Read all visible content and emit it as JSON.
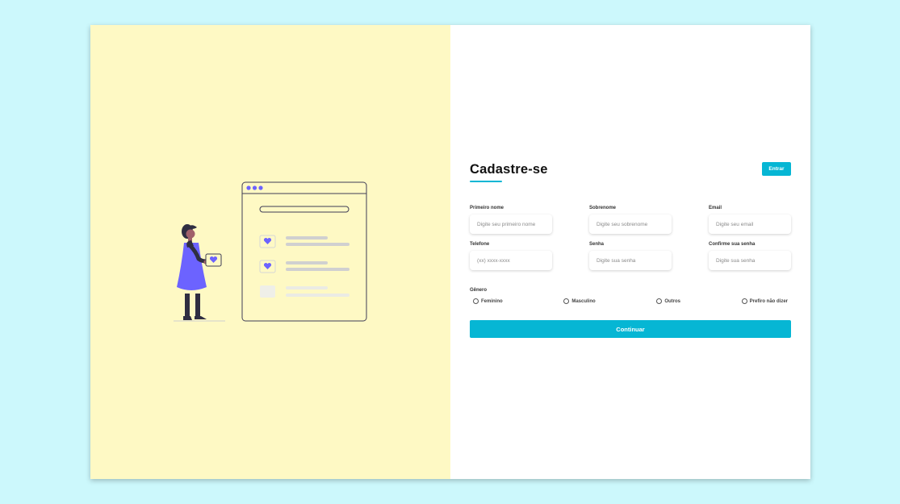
{
  "form": {
    "title": "Cadastre-se",
    "login_button": "Entrar",
    "fields": [
      {
        "label": "Primeiro nome",
        "placeholder": "Digite seu primeiro nome"
      },
      {
        "label": "Sobrenome",
        "placeholder": "Digite seu sobrenome"
      },
      {
        "label": "Email",
        "placeholder": "Digite seu email"
      },
      {
        "label": "Telefone",
        "placeholder": "(xx) xxxx-xxxx"
      },
      {
        "label": "Senha",
        "placeholder": "Digite sua senha"
      },
      {
        "label": "Confirme sua senha",
        "placeholder": "Digite sua senha"
      }
    ],
    "gender": {
      "title": "Gênero",
      "options": [
        "Feminino",
        "Masculino",
        "Outros",
        "Prefiro não dizer"
      ]
    },
    "continue_button": "Continuar"
  },
  "colors": {
    "background": "#ccf8fc",
    "illustration_panel": "#fef9c4",
    "accent": "#06b6d4",
    "illustration_purple": "#6c63ff"
  }
}
